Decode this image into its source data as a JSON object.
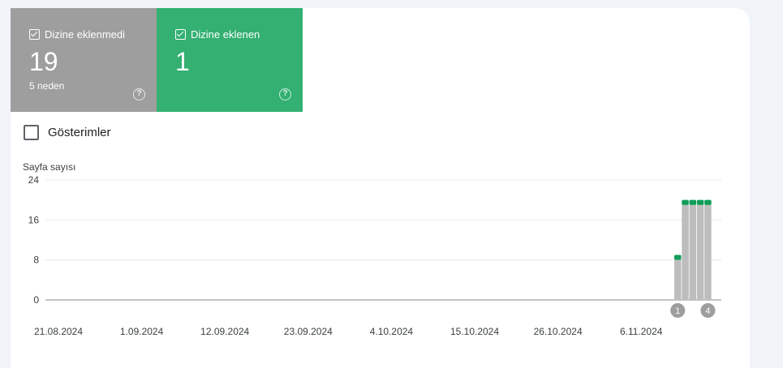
{
  "tiles": {
    "not_indexed": {
      "label": "Dizine eklenmedi",
      "count": "19",
      "sub": "5 neden",
      "help": "?"
    },
    "indexed": {
      "label": "Dizine eklenen",
      "count": "1",
      "help": "?"
    }
  },
  "impressions": {
    "label": "Gösterimler"
  },
  "colors": {
    "not_indexed": "#9e9e9e",
    "indexed": "#33b072",
    "bar_gray": "#bdbdbd",
    "bar_green": "#0f9d58",
    "marker": "#9e9e9e"
  },
  "chart_data": {
    "type": "bar",
    "stacked": true,
    "ylabel": "Sayfa sayısı",
    "ylim": [
      0,
      24
    ],
    "yticks": [
      0,
      8,
      16,
      24
    ],
    "x_tick_labels": [
      "21.08.2024",
      "1.09.2024",
      "12.09.2024",
      "23.09.2024",
      "4.10.2024",
      "15.10.2024",
      "26.10.2024",
      "6.11.2024"
    ],
    "series": [
      {
        "name": "Dizine eklenmedi",
        "values": [
          8,
          19,
          19,
          19,
          19
        ]
      },
      {
        "name": "Dizine eklenen",
        "values": [
          1,
          1,
          1,
          1,
          1
        ]
      }
    ],
    "annotations": [
      {
        "label": "1",
        "bar_index": 0
      },
      {
        "label": "4",
        "bar_index": 4
      }
    ],
    "grid": true
  }
}
